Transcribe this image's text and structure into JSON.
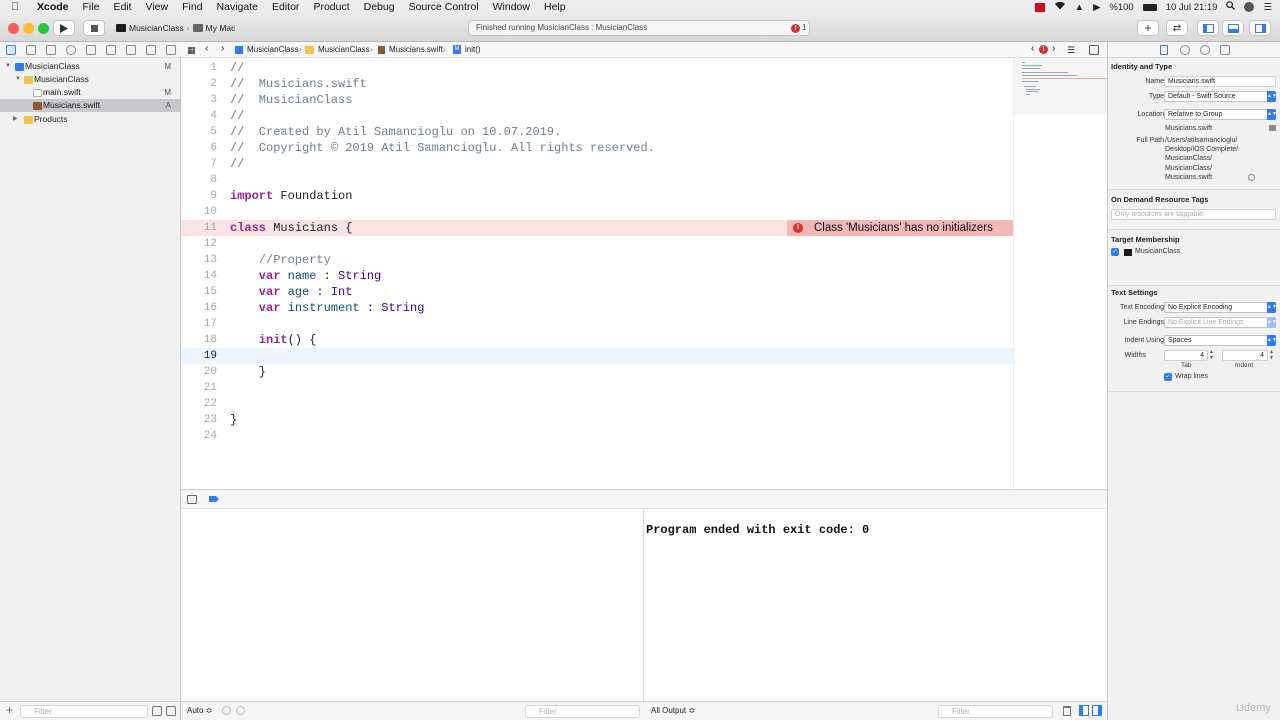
{
  "menubar": {
    "apple": "",
    "items": [
      "Xcode",
      "File",
      "Edit",
      "View",
      "Find",
      "Navigate",
      "Editor",
      "Product",
      "Debug",
      "Source Control",
      "Window",
      "Help"
    ],
    "battery": "%100",
    "clock": "10 Jul  21:19"
  },
  "toolbar": {
    "scheme": "MusicianClass",
    "destination": "My Mac",
    "activity_status": "Finished running MusicianClass : MusicianClass",
    "issue_count": "1"
  },
  "navigator": {
    "items": [
      {
        "label": "MusicianClass",
        "status": "M"
      },
      {
        "label": "MusicianClass",
        "status": ""
      },
      {
        "label": "main.swift",
        "status": "M"
      },
      {
        "label": "Musicians.swift",
        "status": "A"
      },
      {
        "label": "Products",
        "status": ""
      }
    ],
    "filter_placeholder": "Filter"
  },
  "jumpbar": {
    "crumbs": [
      "MusicianClass",
      "MusicianClass",
      "Musicians.swift",
      "init()"
    ]
  },
  "editor": {
    "error_message": "Class 'Musicians' has no initializers",
    "lines": [
      {
        "num": "1",
        "text": "//"
      },
      {
        "num": "2",
        "text": "//  Musicians.swift"
      },
      {
        "num": "3",
        "text": "//  MusicianClass"
      },
      {
        "num": "4",
        "text": "//"
      },
      {
        "num": "5",
        "text": "//  Created by Atil Samancioglu on 10.07.2019."
      },
      {
        "num": "6",
        "text": "//  Copyright © 2019 Atil Samancioglu. All rights reserved."
      },
      {
        "num": "7",
        "text": "//"
      },
      {
        "num": "8",
        "text": ""
      },
      {
        "num": "9",
        "kw": "import",
        "rest": " Foundation"
      },
      {
        "num": "10",
        "text": ""
      },
      {
        "num": "11",
        "kw": "class",
        "rest": " Musicians {"
      },
      {
        "num": "12",
        "text": ""
      },
      {
        "num": "13",
        "text": "    //Property"
      },
      {
        "num": "14",
        "kw": "    var",
        "name": " name",
        "sep": " : ",
        "type": "String"
      },
      {
        "num": "15",
        "kw": "    var",
        "name": " age",
        "sep": " : ",
        "type": "Int"
      },
      {
        "num": "16",
        "kw": "    var",
        "name": " instrument",
        "sep": " : ",
        "type": "String"
      },
      {
        "num": "17",
        "text": ""
      },
      {
        "num": "18",
        "kw": "    init",
        "rest": "() {"
      },
      {
        "num": "19",
        "text": ""
      },
      {
        "num": "20",
        "text": "    }"
      },
      {
        "num": "21",
        "text": ""
      },
      {
        "num": "22",
        "text": ""
      },
      {
        "num": "23",
        "text": "}"
      },
      {
        "num": "24",
        "text": ""
      }
    ]
  },
  "debug": {
    "console_output": "Program ended with exit code: 0",
    "auto_label": "Auto ≎",
    "output_selector": "All Output ≎",
    "filter_placeholder": "Filter"
  },
  "inspector": {
    "identity_header": "Identity and Type",
    "name_label": "Name",
    "name_value": "Musicians.swift",
    "type_label": "Type",
    "type_value": "Default - Swift Source",
    "location_label": "Location",
    "location_value": "Relative to Group",
    "location_file": "Musicians.swift",
    "fullpath_label": "Full Path",
    "fullpath_lines": [
      "/Users/atilsamancioglu/",
      "Desktop/iOS Complete/",
      "MusicianClass/",
      "MusicianClass/",
      "Musicians.swift"
    ],
    "odr_header": "On Demand Resource Tags",
    "odr_placeholder": "Only resources are taggable",
    "target_header": "Target Membership",
    "target_name": "MusicianClass",
    "text_header": "Text Settings",
    "encoding_label": "Text Encoding",
    "encoding_value": "No Explicit Encoding",
    "endings_label": "Line Endings",
    "endings_value": "No Explicit Line Endings",
    "indent_label": "Indent Using",
    "indent_value": "Spaces",
    "widths_label": "Widths",
    "tab_value": "4",
    "indent_width_value": "4",
    "tab_caption": "Tab",
    "indent_caption": "Indent",
    "wrap_label": "Wrap lines"
  },
  "watermark": "Udemy"
}
